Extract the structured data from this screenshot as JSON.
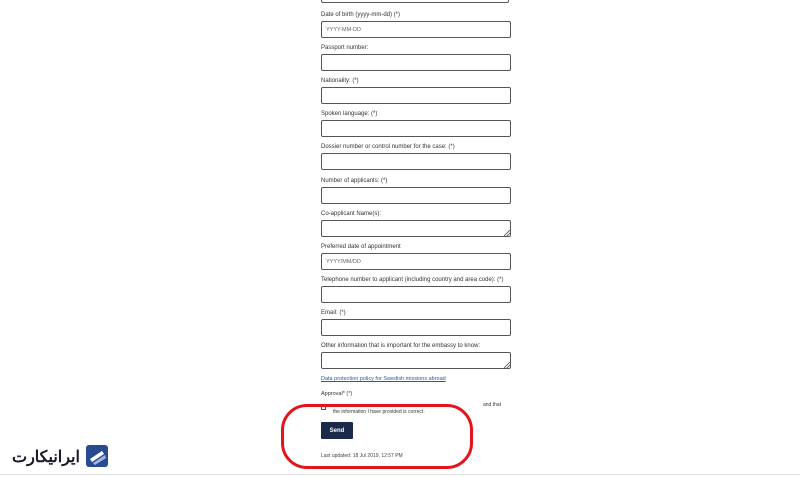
{
  "form": {
    "dob": {
      "label": "Date of birth (yyyy-mm-dd) (*)",
      "placeholder": "YYYY-MM-DD"
    },
    "passport": {
      "label": "Passport number:",
      "value": ""
    },
    "nationality": {
      "label": "Nationality: (*)",
      "value": ""
    },
    "language": {
      "label": "Spoken language: (*)",
      "value": ""
    },
    "dossier": {
      "label": "Dossier number or control number for the case: (*)",
      "value": ""
    },
    "applicants": {
      "label": "Number of applicants: (*)",
      "value": ""
    },
    "coapplicant": {
      "label": "Co-applicant Name(s):",
      "value": ""
    },
    "appointment": {
      "label": "Preferred date of appointment",
      "placeholder": "YYYY/MM/DD"
    },
    "telephone": {
      "label": "Telephone number to applicant (including country and area code): (*)",
      "value": ""
    },
    "email": {
      "label": "Email: (*)",
      "value": ""
    },
    "other": {
      "label": "Other information that is important for the embassy to know:",
      "value": ""
    },
    "policy_link": "Data protection policy for Swedish missions abroad",
    "approval": {
      "label": "Approval* (*)",
      "consent_line1": "and that",
      "consent_line2": "the information I have provided is correct.",
      "checked": false
    },
    "send_label": "Send",
    "last_updated": "Last updated: 18 Jul 2019, 12:57 PM"
  },
  "watermark": {
    "text": "ایرانیکارت"
  },
  "colors": {
    "send_button": "#1b2a4a",
    "highlight": "#e3141b",
    "link": "#2a5b9c"
  }
}
